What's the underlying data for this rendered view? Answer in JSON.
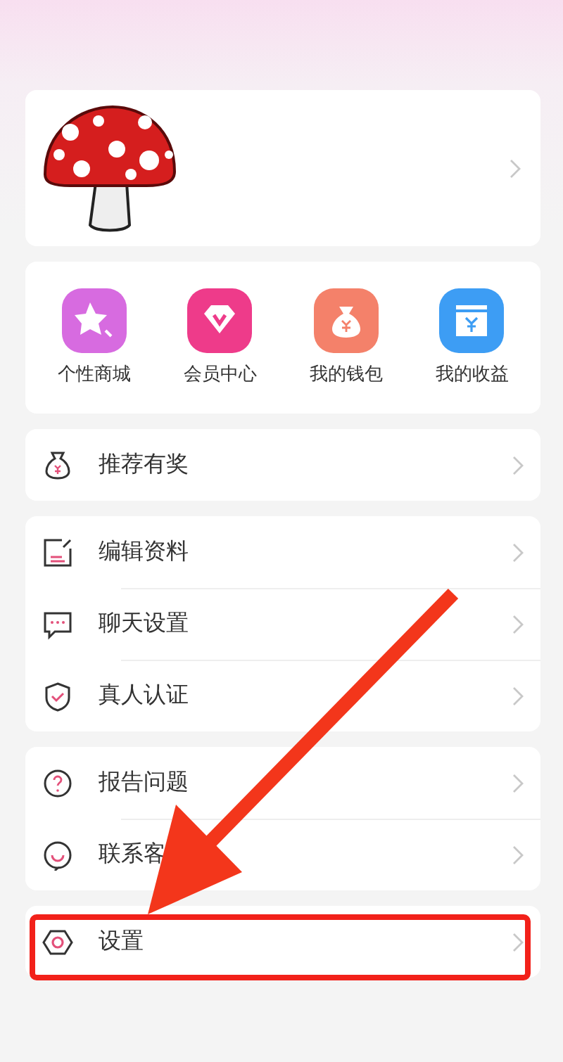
{
  "shortcuts": [
    {
      "label": "个性商城"
    },
    {
      "label": "会员中心"
    },
    {
      "label": "我的钱包"
    },
    {
      "label": "我的收益"
    }
  ],
  "menu_groups": [
    [
      {
        "label": "推荐有奖"
      }
    ],
    [
      {
        "label": "编辑资料"
      },
      {
        "label": "聊天设置"
      },
      {
        "label": "真人认证"
      }
    ],
    [
      {
        "label": "报告问题"
      },
      {
        "label": "联系客"
      }
    ],
    [
      {
        "label": "设置"
      }
    ]
  ]
}
